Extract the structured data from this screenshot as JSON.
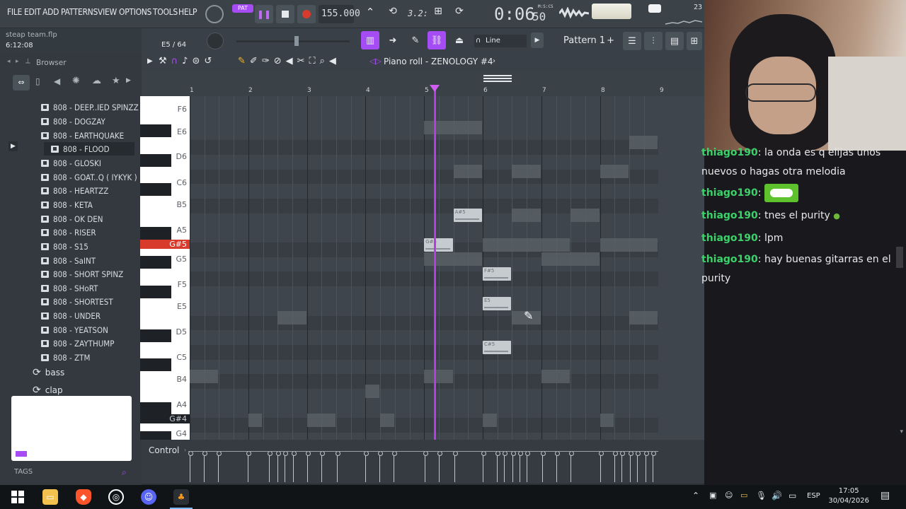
{
  "menu": [
    "FILE",
    "EDIT",
    "ADD",
    "PATTERNS",
    "VIEW",
    "OPTIONS",
    "TOOLS",
    "HELP"
  ],
  "project": {
    "file": "steap team.flp",
    "duration": "6:12:08"
  },
  "transport": {
    "pat_label": "PAT",
    "tempo": "155.000",
    "time_main": "0:06",
    "time_sub": "50",
    "time_unit": "M:S:CS",
    "snap_value": "3.2:",
    "cpu": "23"
  },
  "toolbar2": {
    "step_counter": "E5 / 64",
    "snap_mode": "Line",
    "pattern": "Pattern 1",
    "pattern_add": "+"
  },
  "browser": {
    "title": "Browser",
    "items": [
      "808 - DEEP..IED SPINZZ",
      "808 - DOGZAY",
      "808 - EARTHQUAKE",
      "808 - FLOOD",
      "808 - GLOSKI",
      "808 - GOAT..Q ( IYKYK )",
      "808 - HEARTZZ",
      "808 - KETA",
      "808 - OK DEN",
      "808 - RISER",
      "808 - S15",
      "808 - SaINT",
      "808 - SHORT SPINZ",
      "808 - SHoRT",
      "808 - SHORTEST",
      "808 - UNDER",
      "808 - YEATSON",
      "808 - ZAYTHUMP",
      "808 - ZTM"
    ],
    "selected": "808 - FLOOD",
    "folders": [
      "bass",
      "clap"
    ],
    "tags_label": "TAGS"
  },
  "piano_roll": {
    "title": "Piano roll - ZENOLOGY #4",
    "bars": [
      "1",
      "2",
      "3",
      "4",
      "5",
      "6",
      "7",
      "8",
      "9"
    ],
    "key_labels": [
      "F6",
      "E6",
      "D6",
      "C6",
      "B5",
      "A5",
      "G#5",
      "G5",
      "F5",
      "E5",
      "D5",
      "C5",
      "B4",
      "A4",
      "G#4",
      "G4"
    ],
    "highlighted_key": "G#5",
    "notes": [
      {
        "label": "A#5"
      },
      {
        "label": "G#5"
      },
      {
        "label": "F#5"
      },
      {
        "label": "E5"
      },
      {
        "label": "C#5"
      }
    ],
    "control_label": "Control"
  },
  "chat": {
    "messages": [
      {
        "user": "thiago190",
        "text": "la onda es q elijas unos nuevos o hagas otra melodia"
      },
      {
        "user": "thiago190",
        "text": ""
      },
      {
        "user": "thiago190",
        "text": "tnes el purity"
      },
      {
        "user": "thiago190",
        "text": "lpm"
      },
      {
        "user": "thiago190",
        "text": "hay buenas gitarras en el purity"
      }
    ]
  },
  "taskbar": {
    "language": "ESP",
    "time": "17:05",
    "date": "30/04/2026"
  },
  "colors": {
    "accent": "#a64cf5",
    "playhead": "#b63ce4",
    "key_highlight": "#d83b2c",
    "chat_user": "#3cd16a"
  }
}
